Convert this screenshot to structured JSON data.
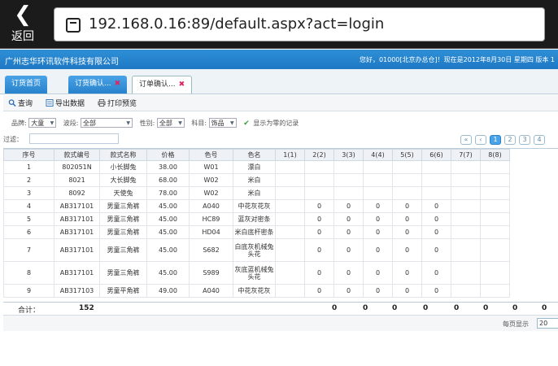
{
  "browser": {
    "back_label": "返回",
    "url": "192.168.0.16:89/default.aspx?act=login"
  },
  "header": {
    "company": "广州志华环讯软件科技有限公司",
    "welcome": "您好，01000[北京办总仓]！现在是2012年8月30日 星期四 版本 1"
  },
  "tabs": [
    {
      "label": "订货首页"
    },
    {
      "label": "订货确认..."
    },
    {
      "label": "订单确认..."
    }
  ],
  "toolbar": {
    "query": "查询",
    "export": "导出数据",
    "print": "打印预览"
  },
  "filters": {
    "brand_label": "品牌:",
    "brand_value": "大童",
    "band_label": "波段:",
    "band_value": "全部",
    "gender_label": "性别:",
    "gender_value": "全部",
    "subject_label": "科目:",
    "subject_value": "饰品",
    "show_zero": "显示为零的记录",
    "filter_label": "过滤："
  },
  "pager": {
    "pages": [
      "1",
      "2",
      "3",
      "4"
    ]
  },
  "table": {
    "columns": [
      "序号",
      "款式编号",
      "款式名称",
      "价格",
      "色号",
      "色名",
      "1(1)",
      "2(2)",
      "3(3)",
      "4(4)",
      "5(5)",
      "6(6)",
      "7(7)",
      "8(8)"
    ],
    "rows": [
      [
        "1",
        "802051N",
        "小长脚兔",
        "38.00",
        "W01",
        "漂白",
        "",
        "",
        "",
        "",
        "",
        "",
        "",
        ""
      ],
      [
        "2",
        "8021",
        "大长脚兔",
        "68.00",
        "W02",
        "米白",
        "",
        "",
        "",
        "",
        "",
        "",
        "",
        ""
      ],
      [
        "3",
        "8092",
        "天使兔",
        "78.00",
        "W02",
        "米白",
        "",
        "",
        "",
        "",
        "",
        "",
        "",
        ""
      ],
      [
        "4",
        "AB317101",
        "男童三角裤",
        "45.00",
        "A040",
        "中花灰花灰",
        "",
        "0",
        "0",
        "0",
        "0",
        "0",
        "",
        ""
      ],
      [
        "5",
        "AB317101",
        "男童三角裤",
        "45.00",
        "HC89",
        "蓝灰对密条",
        "",
        "0",
        "0",
        "0",
        "0",
        "0",
        "",
        ""
      ],
      [
        "6",
        "AB317101",
        "男童三角裤",
        "45.00",
        "HD04",
        "米白底杆密条",
        "",
        "0",
        "0",
        "0",
        "0",
        "0",
        "",
        ""
      ],
      [
        "7",
        "AB317101",
        "男童三角裤",
        "45.00",
        "S682",
        "白底灰机械兔头花",
        "",
        "0",
        "0",
        "0",
        "0",
        "0",
        "",
        ""
      ],
      [
        "8",
        "AB317101",
        "男童三角裤",
        "45.00",
        "S989",
        "灰底蓝机械兔头花",
        "",
        "0",
        "0",
        "0",
        "0",
        "0",
        "",
        ""
      ],
      [
        "9",
        "AB317103",
        "男童平角裤",
        "49.00",
        "A040",
        "中花灰花灰",
        "",
        "0",
        "0",
        "0",
        "0",
        "0",
        "",
        ""
      ]
    ]
  },
  "summary": {
    "label": "合计：",
    "total": "152",
    "zeros": [
      "0",
      "0",
      "0",
      "0",
      "0",
      "0",
      "0",
      "0"
    ]
  },
  "footer": {
    "per_page_label": "每页显示",
    "per_page_value": "20"
  }
}
